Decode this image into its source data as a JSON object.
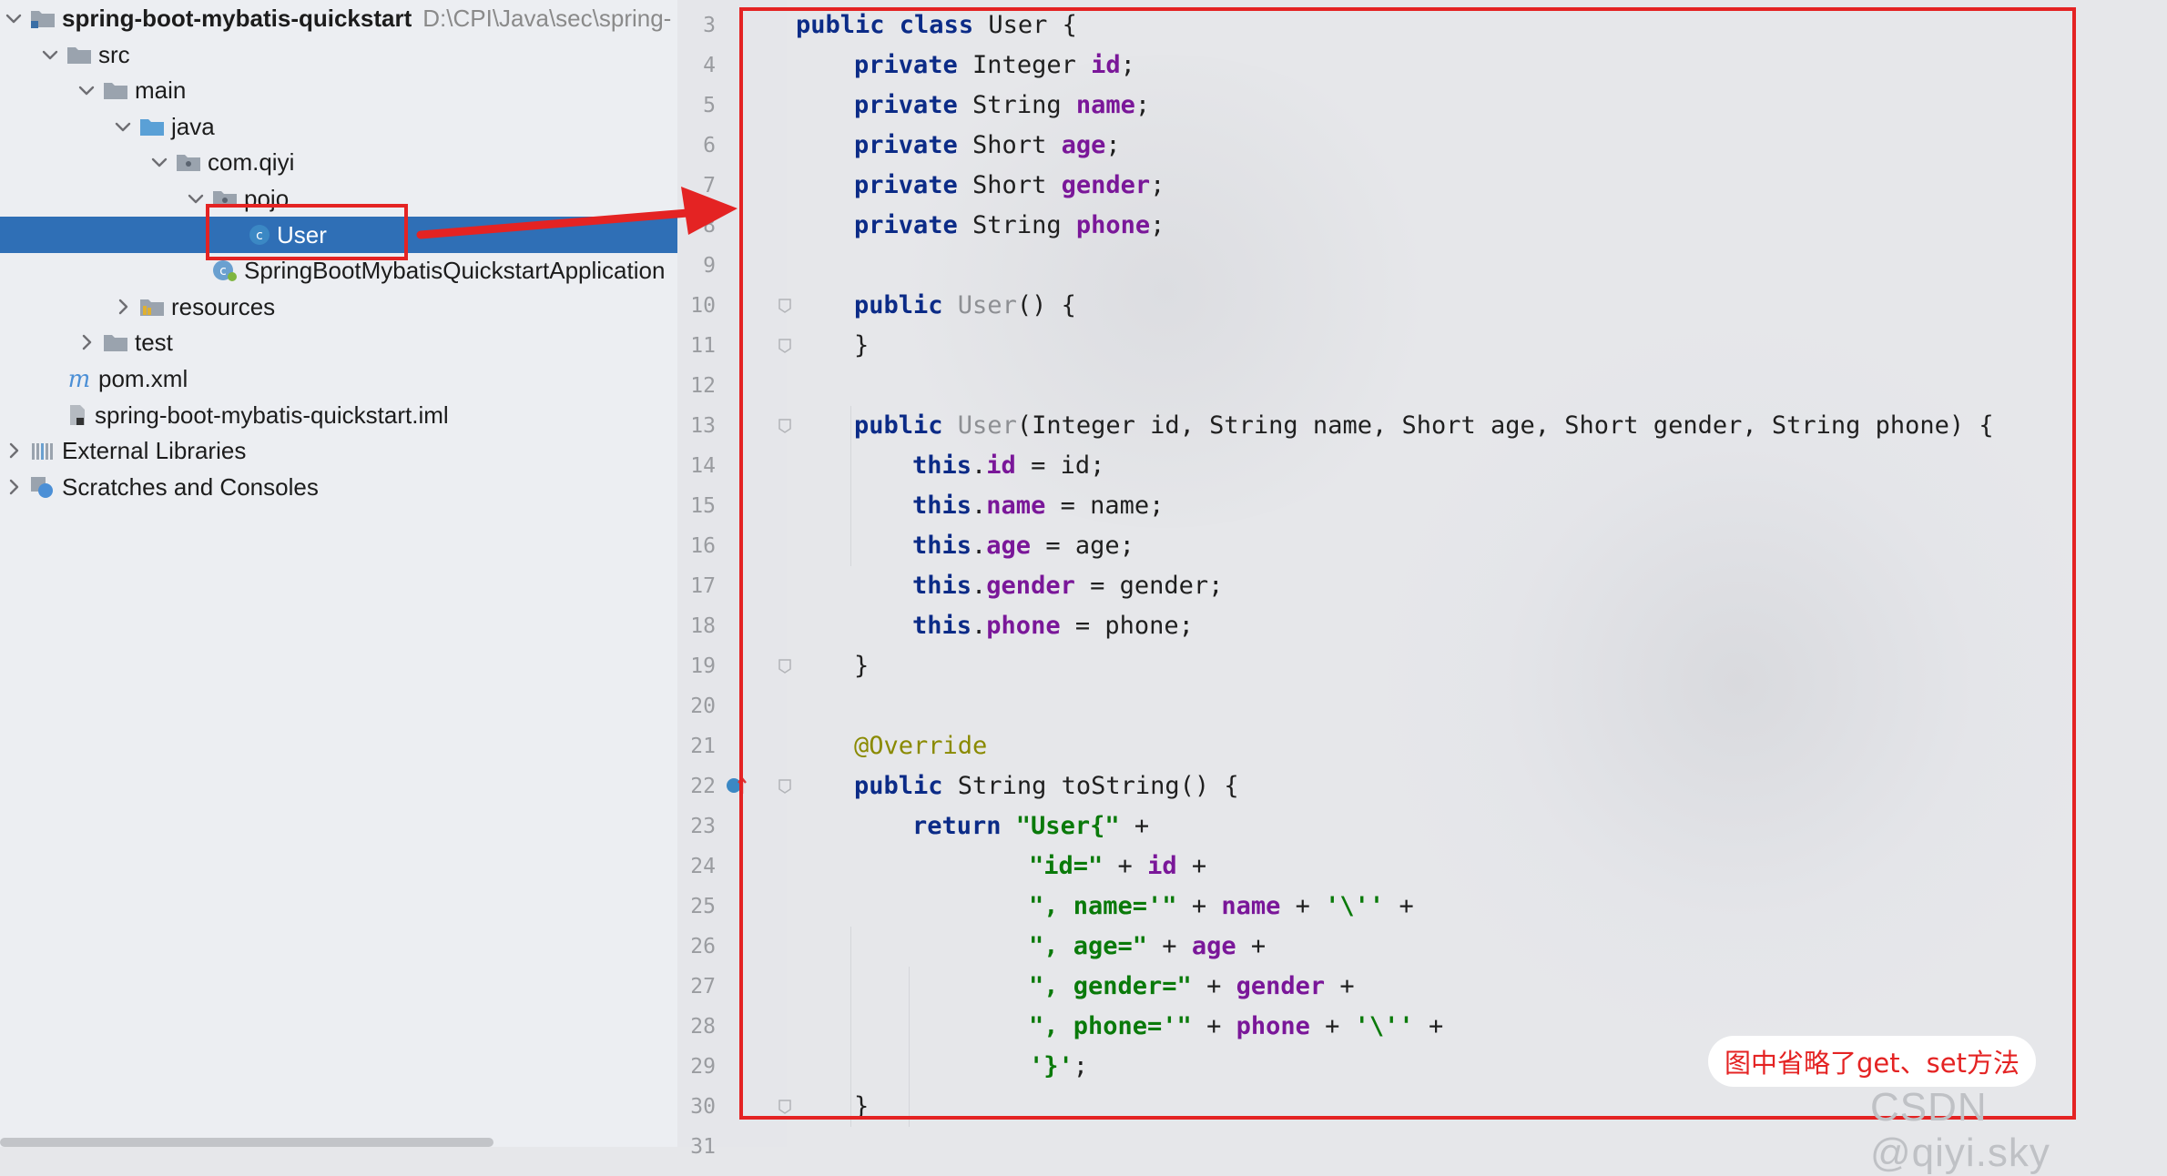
{
  "project_tree": [
    {
      "name": "spring-boot-mybatis-quickstart",
      "path": "D:\\CPI\\Java\\sec\\spring-",
      "icon": "module-folder-icon",
      "level": 0,
      "expanded": true,
      "bold": true
    },
    {
      "name": "src",
      "icon": "folder-icon",
      "level": 1,
      "expanded": true
    },
    {
      "name": "main",
      "icon": "folder-icon",
      "level": 2,
      "expanded": true
    },
    {
      "name": "java",
      "icon": "source-folder-icon",
      "level": 3,
      "expanded": true
    },
    {
      "name": "com.qiyi",
      "icon": "package-icon",
      "level": 4,
      "expanded": true
    },
    {
      "name": "pojo",
      "icon": "package-icon",
      "level": 5,
      "expanded": true
    },
    {
      "name": "User",
      "icon": "class-icon",
      "level": 6,
      "selected": true
    },
    {
      "name": "SpringBootMybatisQuickstartApplication",
      "icon": "spring-class-icon",
      "level": 5
    },
    {
      "name": "resources",
      "icon": "resources-folder-icon",
      "level": 3,
      "expanded": false
    },
    {
      "name": "test",
      "icon": "folder-icon",
      "level": 2,
      "expanded": false
    },
    {
      "name": "pom.xml",
      "icon": "maven-icon",
      "level": 1
    },
    {
      "name": "spring-boot-mybatis-quickstart.iml",
      "icon": "iml-file-icon",
      "level": 1
    },
    {
      "name": "External Libraries",
      "icon": "libraries-icon",
      "level": 0,
      "expanded": false
    },
    {
      "name": "Scratches and Consoles",
      "icon": "scratches-icon",
      "level": 0,
      "expanded": false
    }
  ],
  "code_lines": [
    {
      "n": "3",
      "indent": 0,
      "tokens": [
        [
          "kw",
          "public "
        ],
        [
          "kw",
          "class "
        ],
        [
          "plain",
          "User {"
        ]
      ]
    },
    {
      "n": "4",
      "indent": 1,
      "tokens": [
        [
          "kw",
          "private "
        ],
        [
          "plain",
          "Integer "
        ],
        [
          "fld",
          "id"
        ],
        [
          "plain",
          ";"
        ]
      ]
    },
    {
      "n": "5",
      "indent": 1,
      "tokens": [
        [
          "kw",
          "private "
        ],
        [
          "plain",
          "String "
        ],
        [
          "fld",
          "name"
        ],
        [
          "plain",
          ";"
        ]
      ]
    },
    {
      "n": "6",
      "indent": 1,
      "tokens": [
        [
          "kw",
          "private "
        ],
        [
          "plain",
          "Short "
        ],
        [
          "fld",
          "age"
        ],
        [
          "plain",
          ";"
        ]
      ]
    },
    {
      "n": "7",
      "indent": 1,
      "tokens": [
        [
          "kw",
          "private "
        ],
        [
          "plain",
          "Short "
        ],
        [
          "fld",
          "gender"
        ],
        [
          "plain",
          ";"
        ]
      ]
    },
    {
      "n": "8",
      "indent": 1,
      "tokens": [
        [
          "kw",
          "private "
        ],
        [
          "plain",
          "String "
        ],
        [
          "fld",
          "phone"
        ],
        [
          "plain",
          ";"
        ]
      ]
    },
    {
      "n": "9",
      "indent": 0,
      "tokens": []
    },
    {
      "n": "10",
      "indent": 1,
      "fold": true,
      "tokens": [
        [
          "kw",
          "public "
        ],
        [
          "ctor",
          "User"
        ],
        [
          "plain",
          "() {"
        ]
      ]
    },
    {
      "n": "11",
      "indent": 1,
      "fold": true,
      "tokens": [
        [
          "plain",
          "}"
        ]
      ]
    },
    {
      "n": "12",
      "indent": 0,
      "tokens": []
    },
    {
      "n": "13",
      "indent": 1,
      "fold": true,
      "tokens": [
        [
          "kw",
          "public "
        ],
        [
          "ctor",
          "User"
        ],
        [
          "plain",
          "(Integer id, String name, Short age, Short gender, String phone) {"
        ]
      ]
    },
    {
      "n": "14",
      "indent": 2,
      "tokens": [
        [
          "kw",
          "this"
        ],
        [
          "plain",
          "."
        ],
        [
          "fld",
          "id"
        ],
        [
          "plain",
          " = id;"
        ]
      ]
    },
    {
      "n": "15",
      "indent": 2,
      "tokens": [
        [
          "kw",
          "this"
        ],
        [
          "plain",
          "."
        ],
        [
          "fld",
          "name"
        ],
        [
          "plain",
          " = name;"
        ]
      ]
    },
    {
      "n": "16",
      "indent": 2,
      "tokens": [
        [
          "kw",
          "this"
        ],
        [
          "plain",
          "."
        ],
        [
          "fld",
          "age"
        ],
        [
          "plain",
          " = age;"
        ]
      ]
    },
    {
      "n": "17",
      "indent": 2,
      "tokens": [
        [
          "kw",
          "this"
        ],
        [
          "plain",
          "."
        ],
        [
          "fld",
          "gender"
        ],
        [
          "plain",
          " = gender;"
        ]
      ]
    },
    {
      "n": "18",
      "indent": 2,
      "tokens": [
        [
          "kw",
          "this"
        ],
        [
          "plain",
          "."
        ],
        [
          "fld",
          "phone"
        ],
        [
          "plain",
          " = phone;"
        ]
      ]
    },
    {
      "n": "19",
      "indent": 1,
      "fold": true,
      "tokens": [
        [
          "plain",
          "}"
        ]
      ]
    },
    {
      "n": "20",
      "indent": 0,
      "tokens": []
    },
    {
      "n": "21",
      "indent": 1,
      "tokens": [
        [
          "ann",
          "@Override"
        ]
      ]
    },
    {
      "n": "22",
      "indent": 1,
      "fold": true,
      "tokens": [
        [
          "kw",
          "public "
        ],
        [
          "plain",
          "String toString() {"
        ]
      ]
    },
    {
      "n": "23",
      "indent": 2,
      "tokens": [
        [
          "kw",
          "return "
        ],
        [
          "str",
          "\"User{\""
        ],
        [
          "plain",
          " +"
        ]
      ]
    },
    {
      "n": "24",
      "indent": 4,
      "tokens": [
        [
          "str",
          "\"id=\""
        ],
        [
          "plain",
          " + "
        ],
        [
          "fld",
          "id"
        ],
        [
          "plain",
          " +"
        ]
      ]
    },
    {
      "n": "25",
      "indent": 4,
      "tokens": [
        [
          "str",
          "\", name='\""
        ],
        [
          "plain",
          " + "
        ],
        [
          "fld",
          "name"
        ],
        [
          "plain",
          " + "
        ],
        [
          "str",
          "'\\''"
        ],
        [
          "plain",
          " +"
        ]
      ]
    },
    {
      "n": "26",
      "indent": 4,
      "tokens": [
        [
          "str",
          "\", age=\""
        ],
        [
          "plain",
          " + "
        ],
        [
          "fld",
          "age"
        ],
        [
          "plain",
          " +"
        ]
      ]
    },
    {
      "n": "27",
      "indent": 4,
      "tokens": [
        [
          "str",
          "\", gender=\""
        ],
        [
          "plain",
          " + "
        ],
        [
          "fld",
          "gender"
        ],
        [
          "plain",
          " +"
        ]
      ]
    },
    {
      "n": "28",
      "indent": 4,
      "tokens": [
        [
          "str",
          "\", phone='\""
        ],
        [
          "plain",
          " + "
        ],
        [
          "fld",
          "phone"
        ],
        [
          "plain",
          " + "
        ],
        [
          "str",
          "'\\''"
        ],
        [
          "plain",
          " +"
        ]
      ]
    },
    {
      "n": "29",
      "indent": 4,
      "tokens": [
        [
          "str",
          "'}'"
        ],
        [
          "plain",
          ";"
        ]
      ]
    },
    {
      "n": "30",
      "indent": 1,
      "fold": true,
      "tokens": [
        [
          "plain",
          "}"
        ]
      ]
    },
    {
      "n": "31",
      "indent": 0,
      "tokens": []
    }
  ],
  "gutter": {
    "override_icon": "implements-method-icon",
    "override_line": "22"
  },
  "annotation": {
    "note": "图中省略了get、set方法",
    "highlight_color": "#e42323"
  },
  "watermark": "CSDN @qiyi.sky",
  "colors": {
    "keyword": "#0b2b87",
    "field": "#7a1799",
    "string": "#0a7a0a",
    "annotation": "#8a8a00",
    "selection": "#2f6fb6",
    "highlight": "#e42323"
  }
}
